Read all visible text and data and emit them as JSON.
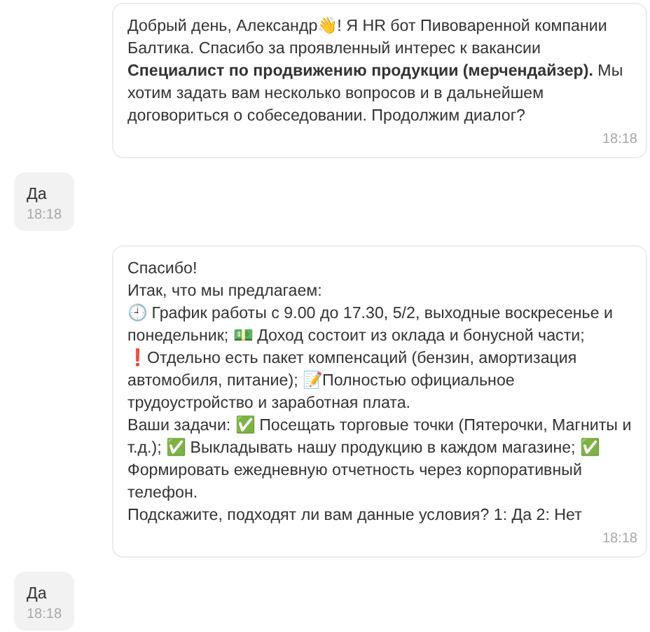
{
  "messages": [
    {
      "kind": "bot",
      "paragraphs": [
        "Добрый день, Александр👋! Я HR бот Пивоваренной компании Балтика. Спасибо за проявленный интерес к вакансии **Специалист по продвижению продукции (мерчендайзер).** Мы хотим задать вам несколько вопросов и в дальнейшем договориться о собеседовании. Продолжим диалог?"
      ],
      "time": "18:18"
    },
    {
      "kind": "user",
      "paragraphs": [
        "Да"
      ],
      "time": "18:18"
    },
    {
      "kind": "bot",
      "paragraphs": [
        "Спасибо!",
        "Итак, что мы предлагаем:",
        "🕘 График работы с 9.00 до 17.30, 5/2, выходные воскресенье и понедельник; 💵 Доход состоит из оклада и бонусной части; ❗Отдельно есть пакет компенсаций (бензин, амортизация автомобиля, питание); 📝Полностью официальное трудоустройство и заработная плата.",
        "Ваши задачи: ✅ Посещать торговые точки (Пятерочки, Магниты и т.д.); ✅ Выкладывать нашу продукцию в каждом магазине; ✅ Формировать ежедневную отчетность через корпоративный телефон.",
        "Подскажите, подходят ли вам данные условия? 1: Да 2: Нет"
      ],
      "time": "18:18"
    },
    {
      "kind": "user",
      "paragraphs": [
        "Да"
      ],
      "time": "18:18"
    }
  ]
}
